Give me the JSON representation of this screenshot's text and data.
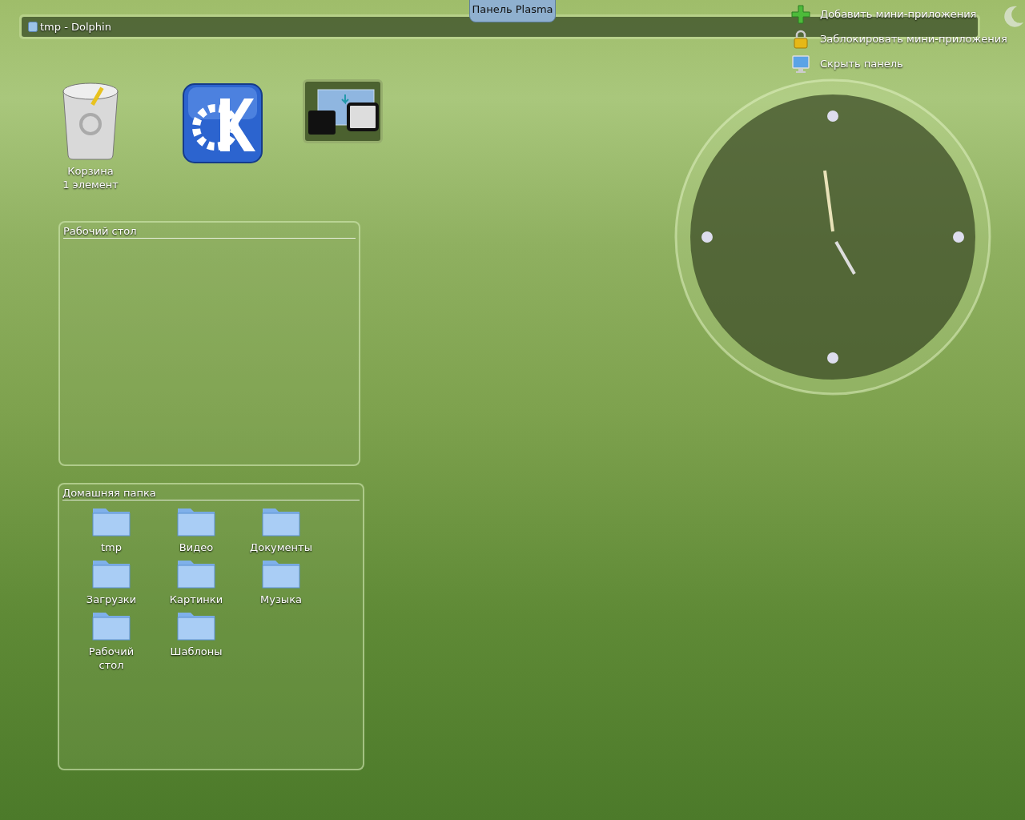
{
  "panel": {
    "panel_tab": "Панель Plasma",
    "tasks": [
      {
        "title": "tmp - Dolphin"
      }
    ]
  },
  "toolbox": {
    "items": [
      {
        "kind": "add",
        "label": "Добавить мини-приложения"
      },
      {
        "kind": "lock",
        "label": "Заблокировать мини-приложения"
      },
      {
        "kind": "hide",
        "label": "Скрыть панель"
      }
    ]
  },
  "desktop_icons": [
    {
      "kind": "trash",
      "label": "Корзина",
      "sublabel": "1 элемент",
      "selected": false
    },
    {
      "kind": "kde",
      "selected": false
    },
    {
      "kind": "device",
      "selected": true
    }
  ],
  "folder_views": [
    {
      "title": "Рабочий стол"
    },
    {
      "title": "Домашняя папка",
      "items": [
        {
          "label": "tmp"
        },
        {
          "label": "Видео"
        },
        {
          "label": "Документы"
        },
        {
          "label": "Загрузки"
        },
        {
          "label": "Картинки"
        },
        {
          "label": "Музыка"
        },
        {
          "label": "Рабочий стол"
        },
        {
          "label": "Шаблоны"
        }
      ]
    }
  ]
}
